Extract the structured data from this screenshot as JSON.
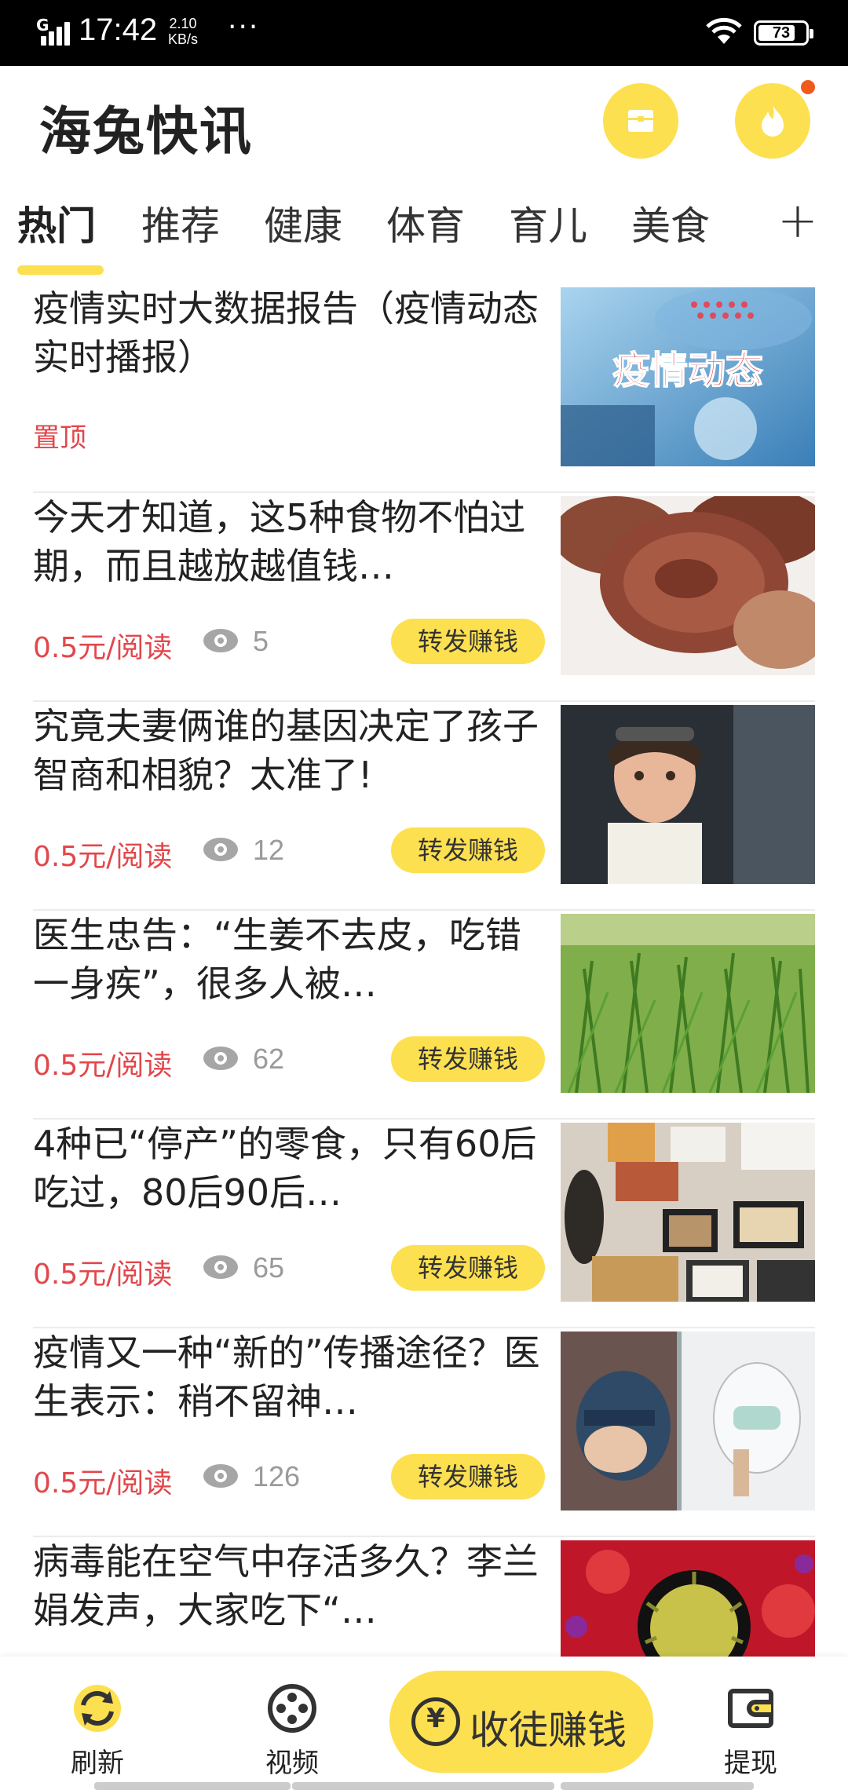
{
  "status_bar": {
    "signal": "G",
    "time": "17:42",
    "speed_value": "2.10",
    "speed_unit": "KB/s",
    "dots": "···",
    "battery": "73"
  },
  "header": {
    "title": "海兔快讯",
    "mail_icon": "mail-icon",
    "fire_icon": "fire-icon",
    "accent_color": "#fde04f",
    "badge_color": "#f25a1c"
  },
  "tabs": {
    "items": [
      "热门",
      "推荐",
      "健康",
      "体育",
      "育儿",
      "美食"
    ],
    "active": "热门",
    "more": "+"
  },
  "feed": {
    "items": [
      {
        "title": "疫情实时大数据报告（疫情动态实时播报）",
        "pin": "置顶",
        "image_text": "疫情动态"
      },
      {
        "title": "今天才知道，这5种食物不怕过期，而且越放越值钱…",
        "reward": "0.5元/阅读",
        "views": "5",
        "share": "转发赚钱"
      },
      {
        "title": "究竟夫妻俩谁的基因决定了孩子智商和相貌？太准了!",
        "reward": "0.5元/阅读",
        "views": "12",
        "share": "转发赚钱"
      },
      {
        "title": "医生忠告：“生姜不去皮，吃错一身疾”，很多人被…",
        "reward": "0.5元/阅读",
        "views": "62",
        "share": "转发赚钱"
      },
      {
        "title": "4种已“停产”的零食，只有60后吃过，80后90后…",
        "reward": "0.5元/阅读",
        "views": "65",
        "share": "转发赚钱"
      },
      {
        "title": "疫情又一种“新的”传播途径？医生表示：稍不留神…",
        "reward": "0.5元/阅读",
        "views": "126",
        "share": "转发赚钱"
      },
      {
        "title": "病毒能在空气中存活多久？李兰娟发声，大家吃下“…"
      }
    ]
  },
  "bottom_nav": {
    "refresh": "刷新",
    "video": "视频",
    "recruit": "收徒赚钱",
    "recruit_symbol": "¥",
    "withdraw": "提现"
  }
}
